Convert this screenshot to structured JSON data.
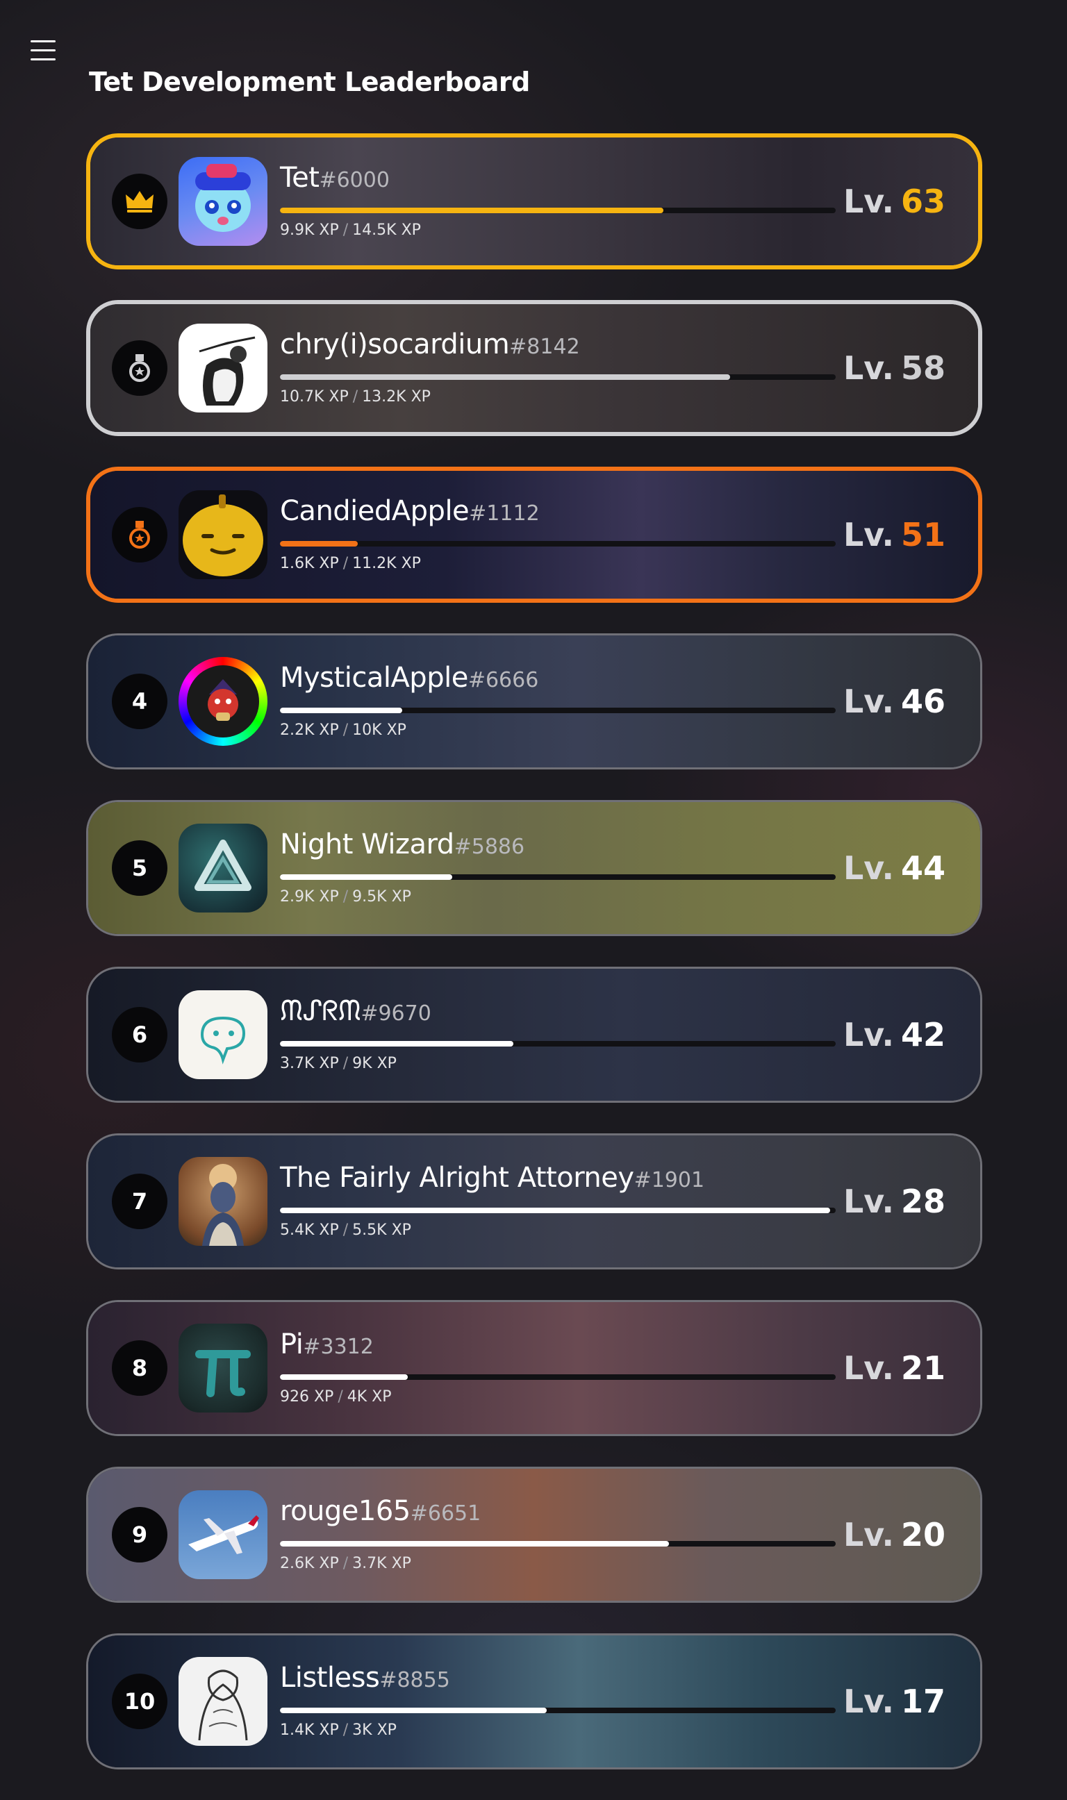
{
  "page": {
    "title": "Tet Development Leaderboard"
  },
  "colors": {
    "gold": "#f6b411",
    "silver": "#cfcfd2",
    "bronze": "#f37217",
    "bar_default": "#ffffff"
  },
  "level_prefix": "Lv.",
  "xp_separator": "/",
  "entries": [
    {
      "rank": "1",
      "rank_icon": "crown-icon",
      "username": "Tet",
      "discriminator": "#6000",
      "xp": "9.9K XP",
      "xp_needed": "14.5K XP",
      "progress": 0.69,
      "level": "63"
    },
    {
      "rank": "2",
      "rank_icon": "medal-icon",
      "username": "chry(i)socardium",
      "discriminator": "#8142",
      "xp": "10.7K XP",
      "xp_needed": "13.2K XP",
      "progress": 0.81,
      "level": "58"
    },
    {
      "rank": "3",
      "rank_icon": "medal-icon",
      "username": "CandiedApple",
      "discriminator": "#1112",
      "xp": "1.6K XP",
      "xp_needed": "11.2K XP",
      "progress": 0.14,
      "level": "51"
    },
    {
      "rank": "4",
      "username": "MysticalApple",
      "discriminator": "#6666",
      "xp": "2.2K XP",
      "xp_needed": "10K XP",
      "progress": 0.22,
      "level": "46"
    },
    {
      "rank": "5",
      "username": "Night Wizard",
      "discriminator": "#5886",
      "xp": "2.9K XP",
      "xp_needed": "9.5K XP",
      "progress": 0.31,
      "level": "44"
    },
    {
      "rank": "6",
      "username": "ᙏᔑᖇᙏ",
      "discriminator": "#9670",
      "xp": "3.7K XP",
      "xp_needed": "9K XP",
      "progress": 0.42,
      "level": "42"
    },
    {
      "rank": "7",
      "username": "The Fairly Alright Attorney",
      "discriminator": "#1901",
      "xp": "5.4K XP",
      "xp_needed": "5.5K XP",
      "progress": 0.99,
      "level": "28"
    },
    {
      "rank": "8",
      "username": "Pi",
      "discriminator": "#3312",
      "xp": "926 XP",
      "xp_needed": "4K XP",
      "progress": 0.23,
      "level": "21"
    },
    {
      "rank": "9",
      "username": "rouge165",
      "discriminator": "#6651",
      "xp": "2.6K XP",
      "xp_needed": "3.7K XP",
      "progress": 0.7,
      "level": "20"
    },
    {
      "rank": "10",
      "username": "Listless",
      "discriminator": "#8855",
      "xp": "1.4K XP",
      "xp_needed": "3K XP",
      "progress": 0.48,
      "level": "17"
    }
  ]
}
